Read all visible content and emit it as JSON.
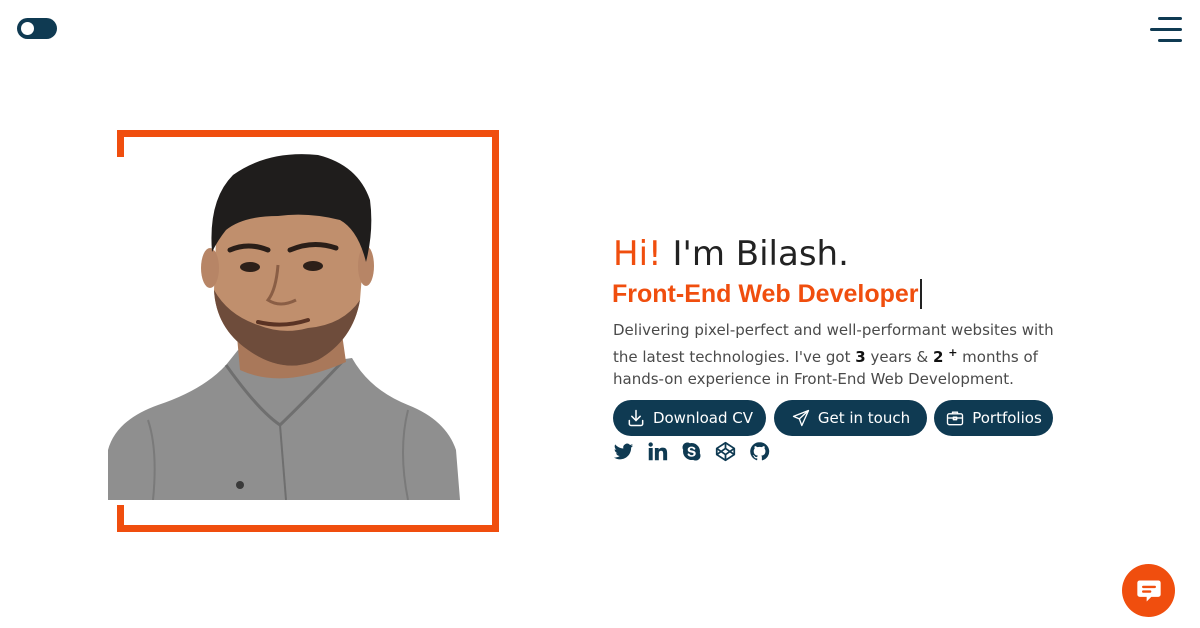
{
  "header": {
    "theme_toggle": {
      "state": "off"
    },
    "menu": {
      "icon": "hamburger-menu-icon"
    }
  },
  "hero": {
    "greeting_hi": "Hi!",
    "greeting_rest": " I'm Bilash.",
    "role": "Front-End Web Developer",
    "bio": {
      "part1": "Delivering pixel-perfect and well-performant websites with the latest technologies. I've got ",
      "years": "3",
      "part2": " years & ",
      "months": "2",
      "plus": "+",
      "part3": " months of hands-on experience in Front-End Web Development."
    },
    "buttons": {
      "download_cv": "Download CV",
      "get_in_touch": "Get in touch",
      "portfolios": "Portfolios"
    },
    "socials": [
      "twitter-icon",
      "linkedin-icon",
      "skype-icon",
      "codepen-icon",
      "github-icon"
    ]
  },
  "colors": {
    "accent": "#f04e0e",
    "primary_dark": "#0f3a52",
    "background": "#ffffff"
  }
}
